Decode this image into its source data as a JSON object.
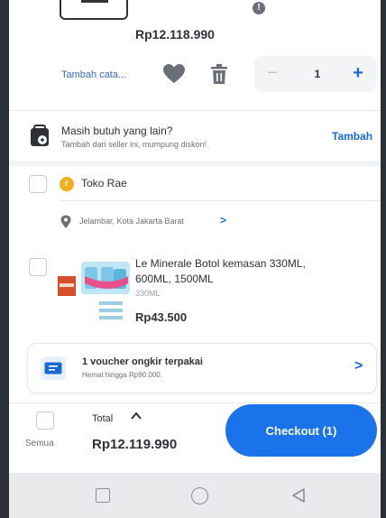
{
  "cart": {
    "previous_item": {
      "price": "Rp12.118.990",
      "note_link": "Tambah cata...",
      "quantity": "1",
      "qty_minus": "−",
      "qty_plus": "+"
    },
    "more_needed": {
      "title": "Masih butuh yang lain?",
      "subtitle": "Tambah dari seller ini, mumpung diskon!",
      "action": "Tambah"
    },
    "shop": {
      "badge": "r",
      "name": "Toko Rae",
      "location": "Jelambar, Kota Jakarta Barat",
      "location_chevron": ">"
    },
    "product": {
      "name": "Le Minerale Botol kemasan 330ML, 600ML, 1500ML",
      "variant": "330ML",
      "price": "Rp43.500"
    }
  },
  "voucher": {
    "title": "1 voucher ongkir terpakai",
    "subtitle": "Hemat hingga Rp90.000.",
    "chevron": ">"
  },
  "footer": {
    "select_all_label": "Semua",
    "total_label": "Total",
    "total_value": "Rp12.119.990",
    "checkout_label": "Checkout (1)"
  },
  "colors": {
    "accent": "#1a73e8",
    "link": "#1a6ad4",
    "text": "#2e3137",
    "muted": "#6b7078"
  }
}
